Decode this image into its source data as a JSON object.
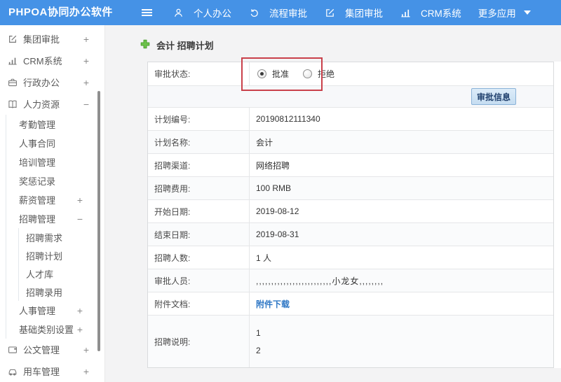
{
  "header": {
    "logo": "PHPOA协同办公软件",
    "nav": [
      {
        "icon": "user-icon",
        "label": "个人办公"
      },
      {
        "icon": "process-icon",
        "label": "流程审批"
      },
      {
        "icon": "edit-icon",
        "label": "集团审批"
      },
      {
        "icon": "bar-chart-icon",
        "label": "CRM系统"
      },
      {
        "icon": "caret-down-icon",
        "label": "更多应用"
      }
    ]
  },
  "sidebar": {
    "items": [
      {
        "label": "集团审批",
        "toggle": "+",
        "icon": "edit-icon",
        "level": 1
      },
      {
        "label": "CRM系统",
        "toggle": "+",
        "icon": "bar-chart-icon",
        "level": 1
      },
      {
        "label": "行政办公",
        "toggle": "+",
        "icon": "briefcase-icon",
        "level": 1
      },
      {
        "label": "人力资源",
        "toggle": "−",
        "icon": "book-icon",
        "level": 1
      },
      {
        "label": "考勤管理",
        "level": 2
      },
      {
        "label": "人事合同",
        "level": 2
      },
      {
        "label": "培训管理",
        "level": 2
      },
      {
        "label": "奖惩记录",
        "level": 2
      },
      {
        "label": "薪资管理",
        "toggle": "+",
        "level": 2
      },
      {
        "label": "招聘管理",
        "toggle": "−",
        "level": 2
      },
      {
        "label": "招聘需求",
        "level": 3
      },
      {
        "label": "招聘计划",
        "level": 3
      },
      {
        "label": "人才库",
        "level": 3
      },
      {
        "label": "招聘录用",
        "level": 3
      },
      {
        "label": "人事管理",
        "toggle": "+",
        "level": 2
      },
      {
        "label": "基础类别设置",
        "toggle": "+",
        "level": 2
      },
      {
        "label": "公文管理",
        "toggle": "+",
        "icon": "document-icon",
        "level": 1
      },
      {
        "label": "用车管理",
        "toggle": "+",
        "icon": "car-icon",
        "level": 1
      }
    ]
  },
  "main": {
    "title": "会计 招聘计划",
    "status_row": {
      "label": "审批状态:",
      "options": [
        {
          "label": "批准",
          "selected": true
        },
        {
          "label": "拒绝",
          "selected": false
        }
      ]
    },
    "approve_button": "审批信息",
    "rows": [
      {
        "label": "计划编号:",
        "value": "20190812111340"
      },
      {
        "label": "计划名称:",
        "value": "会计"
      },
      {
        "label": "招聘渠道:",
        "value": "网络招聘"
      },
      {
        "label": "招聘费用:",
        "value": "100 RMB"
      },
      {
        "label": "开始日期:",
        "value": "2019-08-12"
      },
      {
        "label": "结束日期:",
        "value": "2019-08-31"
      },
      {
        "label": "招聘人数:",
        "value": "1 人"
      },
      {
        "label": "审批人员:",
        "value": ",,,,,,,,,,,,,,,,,,,,,,,,,小龙女,,,,,,,,"
      },
      {
        "label": "附件文档:",
        "value": "附件下载"
      },
      {
        "label": "招聘说明:",
        "lines": [
          "1",
          "2"
        ]
      }
    ],
    "colors": {
      "header_blue": "#4592e6",
      "annotation_red": "#c9404a",
      "link_blue": "#2e77c5",
      "plus_green": "#6dc24b",
      "button_blue": "#c5ddf1"
    }
  }
}
